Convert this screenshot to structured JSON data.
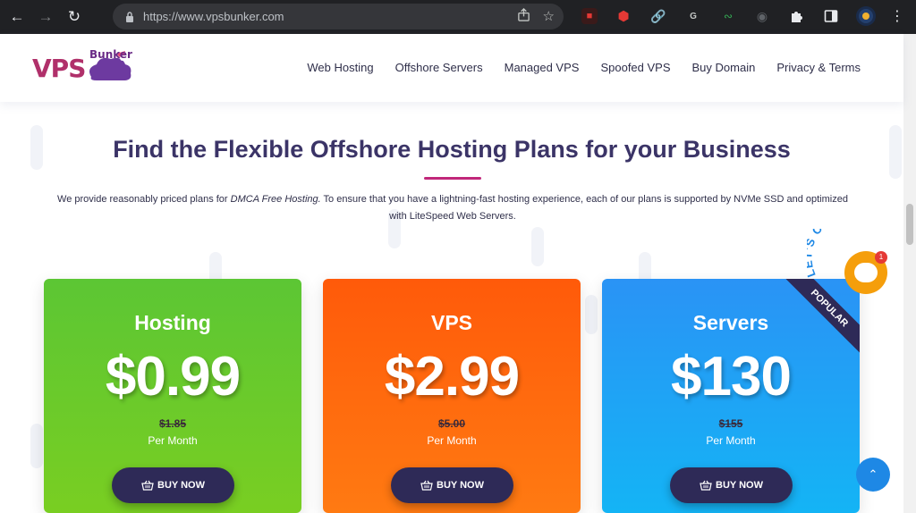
{
  "browser": {
    "url": "https://www.vpsbunker.com",
    "extensions": [
      "red-extension-icon",
      "red-shield-extension-icon",
      "link-extension-icon",
      "gray-extension-icon",
      "green-extension-icon",
      "dark-extension-icon",
      "puzzle-icon",
      "sidepanel-icon",
      "profile-avatar-icon",
      "kebab-menu-icon"
    ]
  },
  "logo": {
    "main": "VPS",
    "sub": "Bunker"
  },
  "nav": [
    "Web Hosting",
    "Offshore Servers",
    "Managed VPS",
    "Spoofed VPS",
    "Buy Domain",
    "Privacy & Terms"
  ],
  "hero": {
    "title": "Find the Flexible Offshore Hosting Plans for your Business",
    "lede_before": "We provide reasonably priced plans for ",
    "lede_em": "DMCA Free Hosting.",
    "lede_after": " To ensure that you have a lightning-fast hosting experience, each of our plans is supported by NVMe SSD and optimized with LiteSpeed Web Servers."
  },
  "plans": [
    {
      "name": "Hosting",
      "price": "$0.99",
      "old_price": "$1.85",
      "period": "Per Month",
      "button": "BUY NOW",
      "color": "#5cc634"
    },
    {
      "name": "VPS",
      "price": "$2.99",
      "old_price": "$5.00",
      "period": "Per Month",
      "button": "BUY NOW",
      "color": "#ff5a0a"
    },
    {
      "name": "Servers",
      "price": "$130",
      "old_price": "$155",
      "period": "Per Month",
      "button": "BUY NOW",
      "color": "#2a93f5",
      "ribbon": "POPULAR"
    }
  ],
  "chat": {
    "label": "LET'S CHAT!",
    "badge": "1"
  },
  "colors": {
    "accent": "#c1277a",
    "navy": "#2e2a57",
    "heading": "#3b3467"
  }
}
